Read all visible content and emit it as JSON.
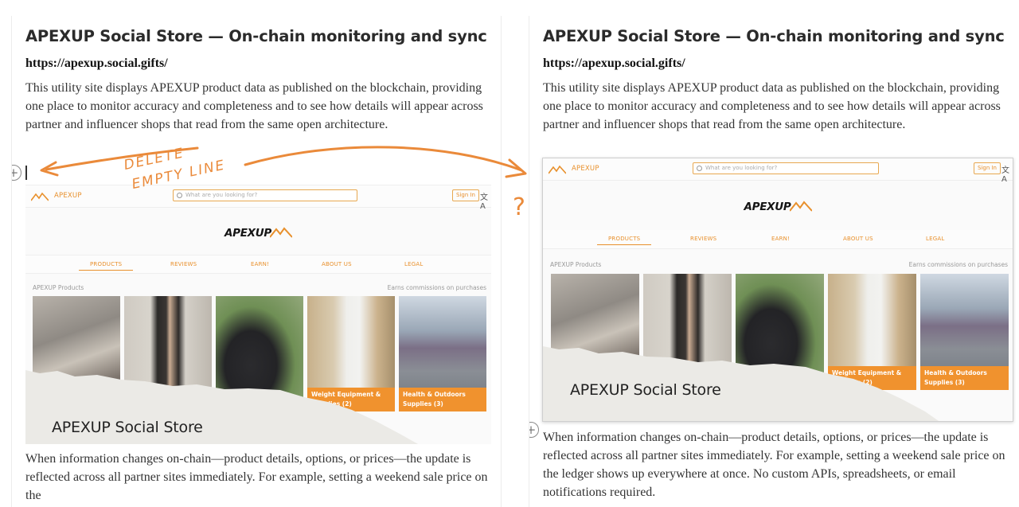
{
  "document": {
    "title": "APEXUP Social Store — On-chain monitoring and sync",
    "url": "https://apexup.social.gifts/",
    "intro": "This utility site displays APEXUP product data as published on the blockchain, providing one place to monitor accuracy and completeness and to see how details will appear across partner and influencer shops that read from the same open architecture.",
    "sync_para_left": "When information changes on-chain—product details, options, or prices—the update is reflected across all partner sites immediately. For example, setting a weekend sale price on the",
    "sync_para_right": "When information changes on-chain—product details, options, or prices—the update is reflected across all partner sites immediately. For example, setting a weekend sale price on the ledger shows up everywhere at once. No custom APIs, spreadsheets, or email notifications required."
  },
  "store_screenshot": {
    "brand": "APEXUP",
    "search_placeholder": "What are you looking for?",
    "signin": "Sign In",
    "lang_icon": "translate-icon",
    "hero_logo": "APEXUP",
    "nav": [
      "PRODUCTS",
      "REVIEWS",
      "EARN!",
      "ABOUT US",
      "LEGAL"
    ],
    "section_label": "APEXUP Products",
    "commission_note": "Earns commissions on purchases",
    "cards": [
      {
        "caption": ""
      },
      {
        "caption": ""
      },
      {
        "caption": ""
      },
      {
        "caption": "Weight Equipment & Supplies (2)"
      },
      {
        "caption": "Health & Outdoors Supplies (3)"
      }
    ],
    "torn_label": "APEXUP Social Store"
  },
  "annotations": {
    "note_line1": "DELETE",
    "note_line2": "EMPTY LINE",
    "question": "?"
  },
  "colors": {
    "accent": "#f0922e",
    "annotation": "#ea8a3a",
    "text": "#333333"
  }
}
